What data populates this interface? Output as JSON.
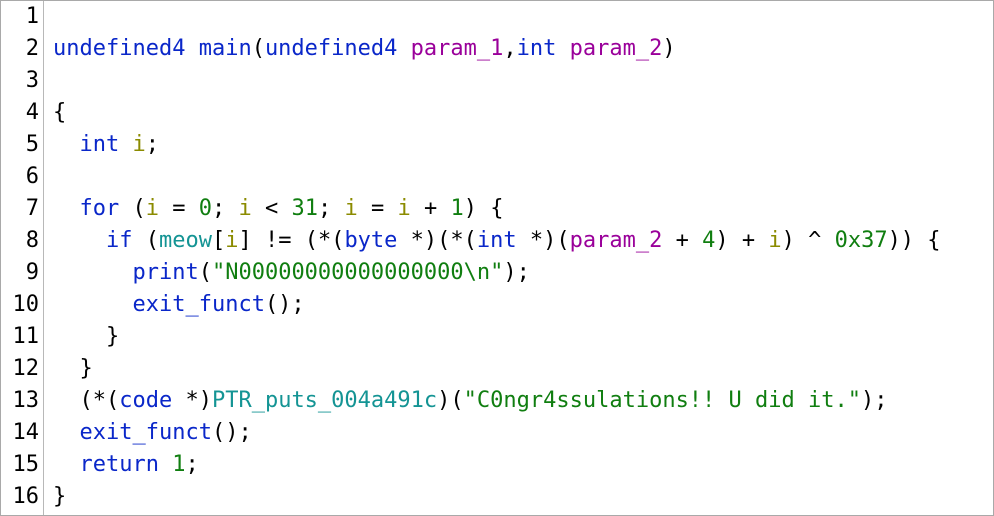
{
  "editor": {
    "lines": [
      {
        "number": "1",
        "tokens": []
      },
      {
        "number": "2",
        "tokens": [
          {
            "text": "undefined4",
            "kind": "type"
          },
          {
            "text": " ",
            "kind": "plain"
          },
          {
            "text": "main",
            "kind": "func"
          },
          {
            "text": "(",
            "kind": "plain"
          },
          {
            "text": "undefined4",
            "kind": "type"
          },
          {
            "text": " ",
            "kind": "plain"
          },
          {
            "text": "param_1",
            "kind": "param"
          },
          {
            "text": ",",
            "kind": "plain"
          },
          {
            "text": "int",
            "kind": "type"
          },
          {
            "text": " ",
            "kind": "plain"
          },
          {
            "text": "param_2",
            "kind": "param"
          },
          {
            "text": ")",
            "kind": "plain"
          }
        ]
      },
      {
        "number": "3",
        "tokens": []
      },
      {
        "number": "4",
        "tokens": [
          {
            "text": "{",
            "kind": "plain"
          }
        ]
      },
      {
        "number": "5",
        "tokens": [
          {
            "text": "  ",
            "kind": "plain"
          },
          {
            "text": "int",
            "kind": "type"
          },
          {
            "text": " ",
            "kind": "plain"
          },
          {
            "text": "i",
            "kind": "local"
          },
          {
            "text": ";",
            "kind": "plain"
          }
        ]
      },
      {
        "number": "6",
        "tokens": []
      },
      {
        "number": "7",
        "tokens": [
          {
            "text": "  ",
            "kind": "plain"
          },
          {
            "text": "for",
            "kind": "keyword"
          },
          {
            "text": " (",
            "kind": "plain"
          },
          {
            "text": "i",
            "kind": "local"
          },
          {
            "text": " = ",
            "kind": "plain"
          },
          {
            "text": "0",
            "kind": "number"
          },
          {
            "text": "; ",
            "kind": "plain"
          },
          {
            "text": "i",
            "kind": "local"
          },
          {
            "text": " < ",
            "kind": "plain"
          },
          {
            "text": "31",
            "kind": "number"
          },
          {
            "text": "; ",
            "kind": "plain"
          },
          {
            "text": "i",
            "kind": "local"
          },
          {
            "text": " = ",
            "kind": "plain"
          },
          {
            "text": "i",
            "kind": "local"
          },
          {
            "text": " + ",
            "kind": "plain"
          },
          {
            "text": "1",
            "kind": "number"
          },
          {
            "text": ") {",
            "kind": "plain"
          }
        ]
      },
      {
        "number": "8",
        "tokens": [
          {
            "text": "    ",
            "kind": "plain"
          },
          {
            "text": "if",
            "kind": "keyword"
          },
          {
            "text": " (",
            "kind": "plain"
          },
          {
            "text": "meow",
            "kind": "global"
          },
          {
            "text": "[",
            "kind": "plain"
          },
          {
            "text": "i",
            "kind": "local"
          },
          {
            "text": "] != (*(",
            "kind": "plain"
          },
          {
            "text": "byte",
            "kind": "type"
          },
          {
            "text": " *)(*(",
            "kind": "plain"
          },
          {
            "text": "int",
            "kind": "type"
          },
          {
            "text": " *)(",
            "kind": "plain"
          },
          {
            "text": "param_2",
            "kind": "param"
          },
          {
            "text": " + ",
            "kind": "plain"
          },
          {
            "text": "4",
            "kind": "number"
          },
          {
            "text": ") + ",
            "kind": "plain"
          },
          {
            "text": "i",
            "kind": "local"
          },
          {
            "text": ") ^ ",
            "kind": "plain"
          },
          {
            "text": "0x37",
            "kind": "number"
          },
          {
            "text": ")) {",
            "kind": "plain"
          }
        ]
      },
      {
        "number": "9",
        "tokens": [
          {
            "text": "      ",
            "kind": "plain"
          },
          {
            "text": "print",
            "kind": "func"
          },
          {
            "text": "(",
            "kind": "plain"
          },
          {
            "text": "\"N00000000000000000\\n\"",
            "kind": "string"
          },
          {
            "text": ");",
            "kind": "plain"
          }
        ]
      },
      {
        "number": "10",
        "tokens": [
          {
            "text": "      ",
            "kind": "plain"
          },
          {
            "text": "exit_funct",
            "kind": "func"
          },
          {
            "text": "();",
            "kind": "plain"
          }
        ]
      },
      {
        "number": "11",
        "tokens": [
          {
            "text": "    }",
            "kind": "plain"
          }
        ]
      },
      {
        "number": "12",
        "tokens": [
          {
            "text": "  }",
            "kind": "plain"
          }
        ]
      },
      {
        "number": "13",
        "tokens": [
          {
            "text": "  (*(",
            "kind": "plain"
          },
          {
            "text": "code",
            "kind": "type"
          },
          {
            "text": " *)",
            "kind": "plain"
          },
          {
            "text": "PTR_puts_004a491c",
            "kind": "global"
          },
          {
            "text": ")(",
            "kind": "plain"
          },
          {
            "text": "\"C0ngr4ssulations!! U did it.\"",
            "kind": "string"
          },
          {
            "text": ");",
            "kind": "plain"
          }
        ]
      },
      {
        "number": "14",
        "tokens": [
          {
            "text": "  ",
            "kind": "plain"
          },
          {
            "text": "exit_funct",
            "kind": "func"
          },
          {
            "text": "();",
            "kind": "plain"
          }
        ]
      },
      {
        "number": "15",
        "tokens": [
          {
            "text": "  ",
            "kind": "plain"
          },
          {
            "text": "return",
            "kind": "keyword"
          },
          {
            "text": " ",
            "kind": "plain"
          },
          {
            "text": "1",
            "kind": "number"
          },
          {
            "text": ";",
            "kind": "plain"
          }
        ]
      },
      {
        "number": "16",
        "tokens": [
          {
            "text": "}",
            "kind": "plain"
          }
        ]
      }
    ]
  },
  "colors": {
    "type": "#0a27c9",
    "func": "#0a27c9",
    "keyword": "#0a27c9",
    "param": "#9a009a",
    "local": "#8b8b00",
    "number": "#107e10",
    "string": "#107e10",
    "global": "#149494",
    "plain": "#000000"
  }
}
